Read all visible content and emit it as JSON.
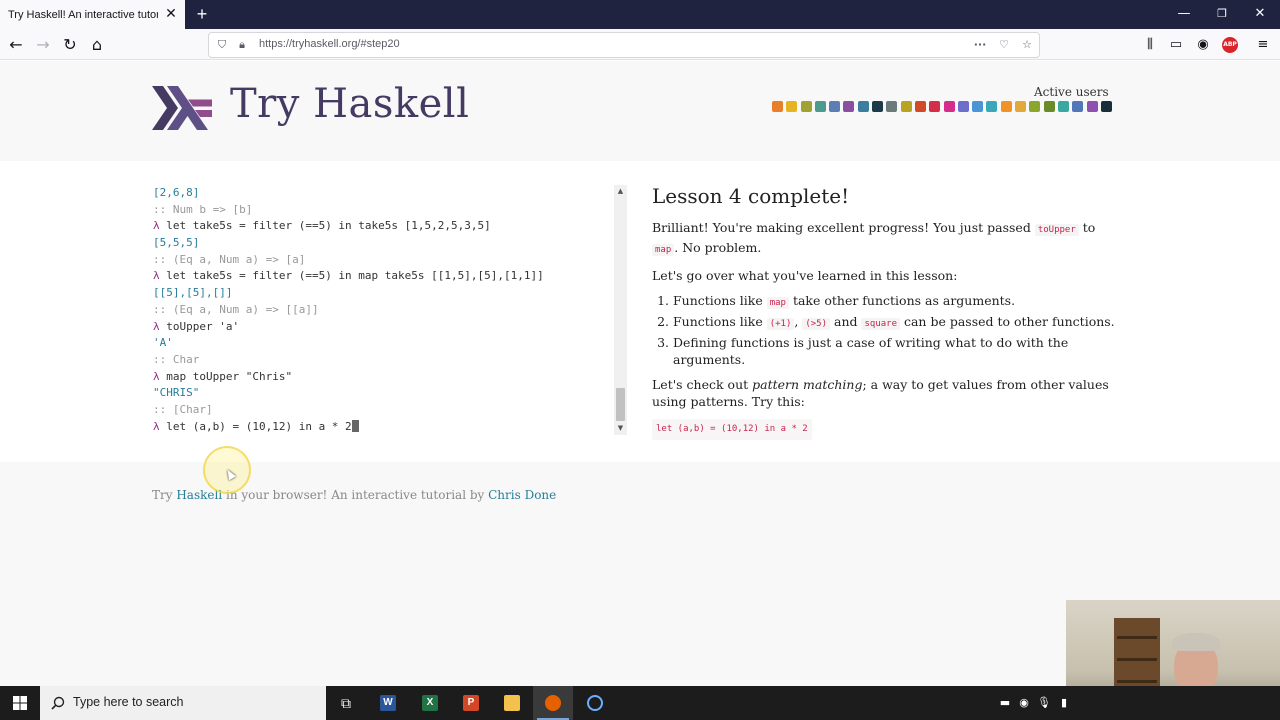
{
  "browser": {
    "tab_title": "Try Haskell! An interactive tutorial in",
    "url": "https://tryhaskell.org/#step20"
  },
  "header": {
    "site_title": "Try Haskell",
    "active_users_label": "Active users",
    "user_colors": [
      "#e87f2b",
      "#e6b422",
      "#a0a331",
      "#4c9a8e",
      "#5b7fb5",
      "#8a4fa0",
      "#3a7fa0",
      "#1d3a4a",
      "#6b7b7b",
      "#b8a420",
      "#d24a26",
      "#d42e49",
      "#d42e8a",
      "#6b6fc9",
      "#4b95d4",
      "#3aa8b8",
      "#f09226",
      "#e2a93a",
      "#8aa62c",
      "#6b8b2a",
      "#3aa8a0",
      "#5177b8",
      "#8f51b0",
      "#1a2f3a"
    ]
  },
  "console": {
    "lines": [
      {
        "kind": "result",
        "text": "[2,6,8]"
      },
      {
        "kind": "type",
        "text": ":: Num b => [b]"
      },
      {
        "kind": "input",
        "prompt": "λ",
        "text": " let take5s = filter (==5) in take5s [1,5,2,5,3,5]"
      },
      {
        "kind": "result",
        "text": "[5,5,5]"
      },
      {
        "kind": "type",
        "text": ":: (Eq a, Num a) => [a]"
      },
      {
        "kind": "input",
        "prompt": "λ",
        "text": " let take5s = filter (==5) in map take5s [[1,5],[5],[1,1]]"
      },
      {
        "kind": "result",
        "text": "[[5],[5],[]]"
      },
      {
        "kind": "type",
        "text": ":: (Eq a, Num a) => [[a]]"
      },
      {
        "kind": "input",
        "prompt": "λ",
        "text": " toUpper 'a'"
      },
      {
        "kind": "result",
        "text": "'A'"
      },
      {
        "kind": "type",
        "text": ":: Char"
      },
      {
        "kind": "input",
        "prompt": "λ",
        "text": " map toUpper \"Chris\""
      },
      {
        "kind": "result",
        "text": "\"CHRIS\""
      },
      {
        "kind": "type",
        "text": ":: [Char]"
      }
    ],
    "current_prompt": "λ",
    "current_input": " let (a,b) = (10,12) in a * 2"
  },
  "lesson": {
    "heading": "Lesson 4 complete!",
    "p1_a": "Brilliant! You're making excellent progress! You just passed ",
    "p1_code1": "toUpper",
    "p1_b": " to ",
    "p1_code2": "map",
    "p1_c": ". No problem.",
    "p2": "Let's go over what you've learned in this lesson:",
    "li1_a": "Functions like ",
    "li1_code": "map",
    "li1_b": " take other functions as arguments.",
    "li2_a": "Functions like ",
    "li2_code1": "(+1)",
    "li2_sep": ", ",
    "li2_code2": "(>5)",
    "li2_and": " and ",
    "li2_code3": "square",
    "li2_b": " can be passed to other functions.",
    "li3": "Defining functions is just a case of writing what to do with the arguments.",
    "p3_a": "Let's check out ",
    "p3_em": "pattern matching",
    "p3_b": "; a way to get values from other values using patterns. Try this:",
    "try_code": "let (a,b) = (10,12) in a * 2"
  },
  "footer": {
    "a": "Try ",
    "link1": "Haskell",
    "b": " in your browser! An interactive tutorial by ",
    "link2": "Chris Done"
  },
  "taskbar": {
    "search_placeholder": "Type here to search"
  }
}
